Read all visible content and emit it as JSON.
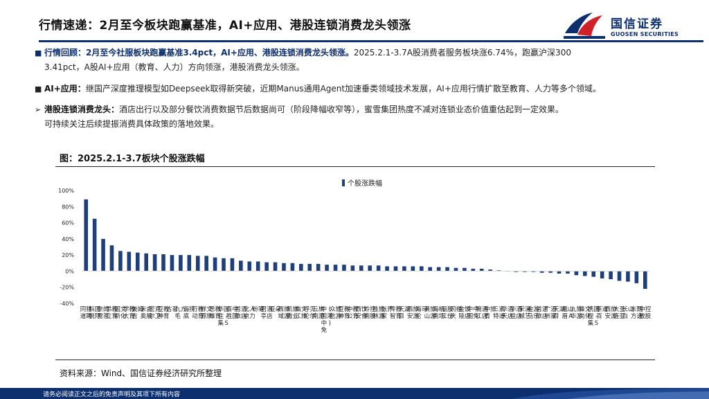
{
  "title": "行情速递：2月至今板块跑赢基准，AI+应用、港股连锁消费龙头领涨",
  "logo": {
    "cn": "国信证券",
    "en": "GUOSEN SECURITIES"
  },
  "bullets": [
    {
      "marker": "■",
      "label": "行情回顾：",
      "highlight": "2月至今社服板块跑赢基准3.4pct，AI+应用、港股连锁消费龙头领涨。",
      "line1_rest": "2025.2.1-3.7A股消费者服务板块涨6.74%，跑赢沪深300",
      "line2": "3.41pct，A股AI+应用（教育、人力）方向领涨，港股消费龙头领涨。"
    },
    {
      "marker": "■",
      "label": "AI+应用：",
      "text": "继国产深度推理模型如Deepseek取得新突破，近期Manus通用Agent加速垂类领域技术发展，AI+应用行情扩散至教育、人力等多个领域。"
    },
    {
      "marker": "➢",
      "label": "港股连锁消费龙头：",
      "text": "酒店出行以及部分餐饮消费数据节后数据尚可（阶段降幅收窄等），蜜雪集团热度不减对连锁业态价值重估起到一定效果。",
      "line2": "可持续关注后续提振消费具体政策的落地效果。"
    }
  ],
  "figure_title": "图：2025.2.1-3.7板块个股涨跌幅",
  "source": "资料来源：Wind、国信证券经济研究所整理",
  "footer": "请务必阅读正文之后的免责声明及其项下所有内容",
  "colors": {
    "navy": "#0d2f6e",
    "bar": "#1f3f7a",
    "red": "#d0202a"
  },
  "chart_data": {
    "type": "bar",
    "legend": "个股涨跌幅",
    "legend_position": "top-left",
    "ylim": [
      -0.4,
      1.0
    ],
    "yticks": [
      -0.4,
      -0.2,
      0,
      0.2,
      0.4,
      0.6,
      0.8,
      1.0
    ],
    "ytick_labels": [
      "-40%",
      "-20%",
      "0%",
      "20%",
      "40%",
      "60%",
      "80%",
      "100%"
    ],
    "grid": false,
    "categories": [
      "同道猎聘",
      "科锐国际",
      "奈雪的茶",
      "昂立教育",
      "国新文化",
      "学大教育",
      "美吉姆",
      "米奥会展",
      "密尔克卫",
      "豆神教育",
      "古茗",
      "九毛九",
      "海底捞",
      "行动教育",
      "祥源文旅",
      "思维教育",
      "华住集团-S",
      "百胜中国",
      "首旅酒店",
      "北京人力",
      "粉笔",
      "君亭酒店",
      "亚朵",
      "西域旅游",
      "凯撒旅业",
      "曲江文旅",
      "呼伦贝尔",
      "云南旅游",
      "中国中免(港)",
      "众信旅游",
      "豆神教育",
      "中公教育",
      "西安饮食",
      "岭南控股",
      "桂林旅游",
      "张家界",
      "传智教育",
      "天目湖",
      "西安旅游",
      "海伦司",
      "黄山旅游",
      "海南机场",
      "丽江股份",
      "同庆楼",
      "金陵饭店",
      "中国中免",
      "锦江酒店",
      "中青旅",
      "三特索道",
      "华天酒店",
      "华住酒店",
      "宋城演艺",
      "金马游乐",
      "首旅酒店",
      "广州酒家",
      "天目湖",
      "峨眉山A",
      "九华旅游",
      "锋尚文化",
      "携程集团-S",
      "茶百道",
      "西安旅游",
      "大连圣亚",
      "长白山",
      "东方甄选",
      "中教控股"
    ],
    "values": [
      0.89,
      0.65,
      0.4,
      0.32,
      0.25,
      0.24,
      0.23,
      0.22,
      0.21,
      0.21,
      0.2,
      0.2,
      0.2,
      0.19,
      0.19,
      0.17,
      0.16,
      0.16,
      0.13,
      0.12,
      0.12,
      0.11,
      0.11,
      0.1,
      0.1,
      0.09,
      0.09,
      0.09,
      0.08,
      0.08,
      0.08,
      0.07,
      0.07,
      0.07,
      0.07,
      0.06,
      0.06,
      0.06,
      0.06,
      0.06,
      0.05,
      0.05,
      0.05,
      0.04,
      0.04,
      0.03,
      0.03,
      0.02,
      0.01,
      0.0,
      -0.01,
      -0.01,
      -0.01,
      -0.02,
      -0.02,
      -0.03,
      -0.03,
      -0.05,
      -0.06,
      -0.07,
      -0.09,
      -0.1,
      -0.12,
      -0.13,
      -0.15,
      -0.22
    ]
  }
}
